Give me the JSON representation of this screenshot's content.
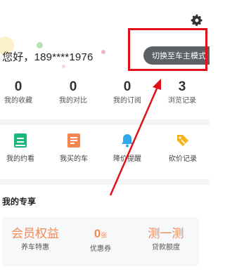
{
  "header": {
    "greeting": "您好，189****1976",
    "switch_mode_label": "切换至车主模式"
  },
  "icons": {
    "settings": "gear-icon",
    "appointments": "calendar-icon",
    "purchased": "document-icon",
    "price_alert": "bell-icon",
    "bargain": "tag-icon"
  },
  "stats": [
    {
      "value": "0",
      "label": "我的收藏"
    },
    {
      "value": "0",
      "label": "我的对比"
    },
    {
      "value": "0",
      "label": "我的订阅"
    },
    {
      "value": "3",
      "label": "浏览记录"
    }
  ],
  "services": [
    {
      "label": "我的约看"
    },
    {
      "label": "我买的车"
    },
    {
      "label": "降价提醒"
    },
    {
      "label": "砍价记录"
    }
  ],
  "exclusive": {
    "title": "我的专享",
    "items": [
      {
        "value": "会员权益",
        "label": "养车特惠"
      },
      {
        "value": "0",
        "unit": "张",
        "label": "优惠券"
      },
      {
        "value": "测一测",
        "label": "贷款额度"
      }
    ]
  },
  "colors": {
    "accent_orange": "#f08a56",
    "annotation_red": "#e0111a",
    "switch_button_bg": "#5d6165",
    "icon_green": "#19b87a",
    "icon_orange": "#f4854f",
    "icon_blue": "#2fa9ea",
    "icon_yellow": "#f7b21a"
  }
}
